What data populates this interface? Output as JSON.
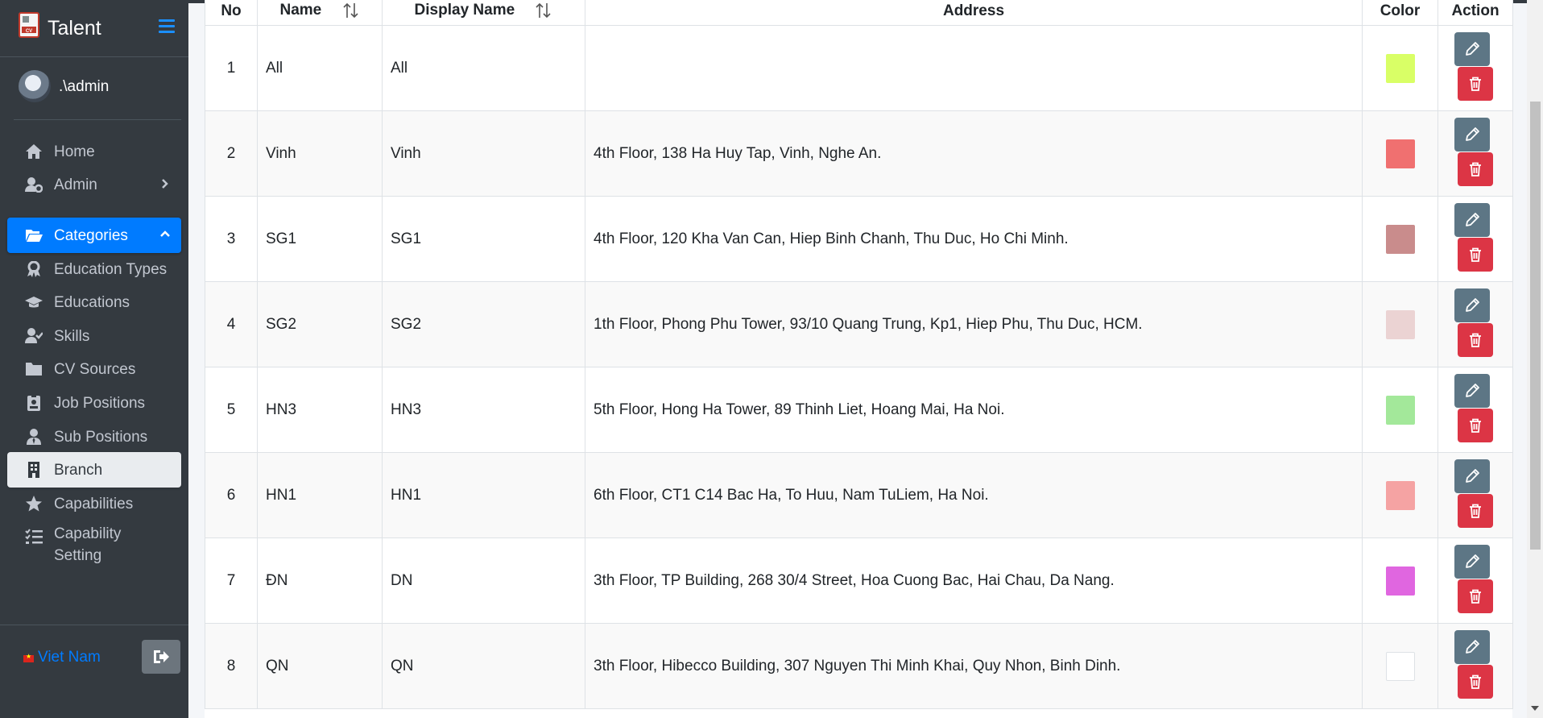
{
  "app": {
    "title": "Talent"
  },
  "user": {
    "name": ".\\admin"
  },
  "nav": [
    {
      "label": "Home",
      "icon": "home-icon"
    },
    {
      "label": "Admin",
      "icon": "user-cog-icon"
    },
    {
      "label": "Categories",
      "icon": "folder-open-icon"
    },
    {
      "label": "Education Types",
      "icon": "award-icon"
    },
    {
      "label": "Educations",
      "icon": "graduation-cap-icon"
    },
    {
      "label": "Skills",
      "icon": "user-check-icon"
    },
    {
      "label": "CV Sources",
      "icon": "folder-icon"
    },
    {
      "label": "Job Positions",
      "icon": "id-badge-icon"
    },
    {
      "label": "Sub Positions",
      "icon": "user-tie-icon"
    },
    {
      "label": "Branch",
      "icon": "building-icon"
    },
    {
      "label": "Capabilities",
      "icon": "star-icon"
    },
    {
      "label": "Capability Setting",
      "icon": "tasks-icon"
    }
  ],
  "footer": {
    "language": "Viet Nam"
  },
  "table": {
    "headers": {
      "no": "No",
      "name": "Name",
      "display_name": "Display Name",
      "address": "Address",
      "color": "Color",
      "action": "Action"
    },
    "rows": [
      {
        "no": "1",
        "name": "All",
        "display_name": "All",
        "address": "",
        "color": "#d9ff66"
      },
      {
        "no": "2",
        "name": "Vinh",
        "display_name": "Vinh",
        "address": "4th Floor, 138 Ha Huy Tap, Vinh, Nghe An.",
        "color": "#f07070"
      },
      {
        "no": "3",
        "name": "SG1",
        "display_name": "SG1",
        "address": "4th Floor, 120 Kha Van Can, Hiep Binh Chanh, Thu Duc, Ho Chi Minh.",
        "color": "#c98c8c"
      },
      {
        "no": "4",
        "name": "SG2",
        "display_name": "SG2",
        "address": "1th Floor, Phong Phu Tower, 93/10 Quang Trung, Kp1, Hiep Phu, Thu Duc, HCM.",
        "color": "#ebd3d3"
      },
      {
        "no": "5",
        "name": "HN3",
        "display_name": "HN3",
        "address": "5th Floor, Hong Ha Tower, 89 Thinh Liet, Hoang Mai, Ha Noi.",
        "color": "#a3e89a"
      },
      {
        "no": "6",
        "name": "HN1",
        "display_name": "HN1",
        "address": "6th Floor, CT1 C14 Bac Ha, To Huu, Nam TuLiem, Ha Noi.",
        "color": "#f5a3a3"
      },
      {
        "no": "7",
        "name": "ĐN",
        "display_name": "DN",
        "address": "3th Floor, TP Building, 268 30/4 Street, Hoa Cuong Bac, Hai Chau, Da Nang.",
        "color": "#e066e0"
      },
      {
        "no": "8",
        "name": "QN",
        "display_name": "QN",
        "address": "3th Floor, Hibecco Building, 307 Nguyen Thi Minh Khai, Quy Nhon, Binh Dinh.",
        "color": "#ffffff"
      }
    ]
  },
  "colors": {
    "sidebar": "#343a40",
    "accent": "#007bff",
    "edit_button": "#5d7685",
    "delete_button": "#dc3545"
  }
}
